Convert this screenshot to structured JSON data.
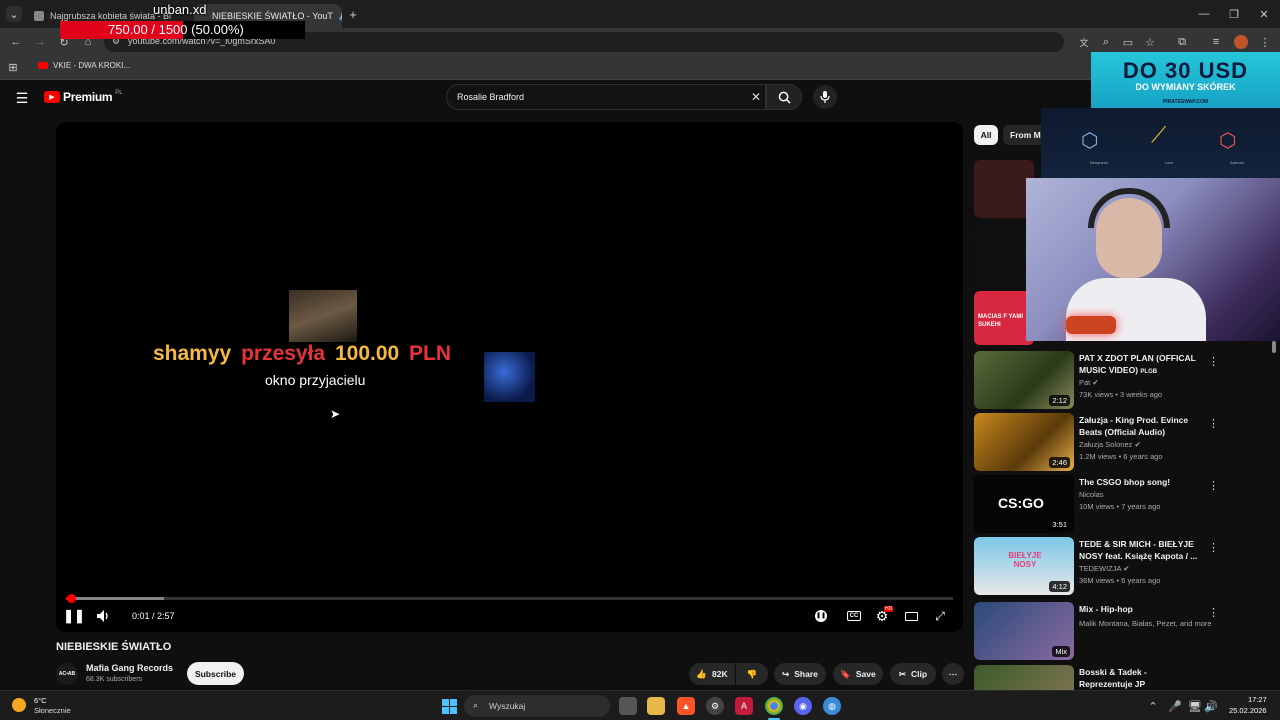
{
  "browser": {
    "tabs": [
      {
        "title": "Najgrubsza kobieta świata - Bi"
      },
      {
        "title": "NIEBIESKIE ŚWIATŁO - YouT"
      }
    ],
    "new_tab": "+",
    "url": "youtube.com/watch?v=_i0gmSrxSA0",
    "bookmark": "VKIE - DWA KROKI..."
  },
  "overlay": {
    "streamer_name": "unban.xd",
    "goal_text": "750.00 / 1500 (50.00%)",
    "goal_fraction": 0.5,
    "ad_title": "DO 30 USD",
    "ad_subtitle": "DO WYMIANY SKÓREK",
    "ad_brand": "PIRATESWAP.COM",
    "ad_skins": [
      "Neoqueen",
      "Lore",
      "Asiimov"
    ],
    "donation": {
      "user": "shamyy",
      "verb": "przesyła",
      "amount": "100.00",
      "currency": "PLN",
      "message": "okno przyjacielu"
    }
  },
  "youtube": {
    "logo": "Premium",
    "logo_region": "PL",
    "search_value": "Rosalie Bradford",
    "player": {
      "time": "0:01 / 2:57",
      "progress_fraction": 0.006,
      "buffered_fraction": 0.11
    },
    "video": {
      "title": "NIEBIESKIE ŚWIATŁO",
      "channel": "Mafia Gang Records",
      "channel_avatar": "AC•AB",
      "subscribers": "68.3K subscribers",
      "subscribe": "Subscribe",
      "likes": "82K",
      "share": "Share",
      "save": "Save",
      "clip": "Clip"
    },
    "chips": [
      "All",
      "From Ma"
    ],
    "recommendations": [
      {
        "title": "PAT X ZDOT PLAN (OFFICAL MUSIC VIDEO)",
        "badge": "PLGB",
        "channel": "Pat",
        "verified": true,
        "meta": "73K views • 3 weeks ago",
        "duration": "2:12",
        "thumb_color": "#5a6b3a"
      },
      {
        "title": "Załuzja - King Prod. Evince Beats (Official Audio)",
        "channel": "Załuzja Solonez",
        "verified": true,
        "meta": "1.2M views • 6 years ago",
        "duration": "2:46",
        "thumb_color": "#c98a1e"
      },
      {
        "title": "The CSGO bhop song!",
        "channel": "Nicolas",
        "verified": false,
        "meta": "10M views • 7 years ago",
        "duration": "3:51",
        "thumb_color": "#050505",
        "thumb_text": "CS:GO"
      },
      {
        "title": "TEDE & SIR MICH - BIEŁYJE NOSY feat. Książę Kapota / ...",
        "channel": "TEDEWIZJA",
        "verified": true,
        "meta": "36M views • 6 years ago",
        "duration": "4:12",
        "thumb_color": "#5ab0d6",
        "thumb_text": "BIEŁYJE NOSY"
      },
      {
        "title": "Mix - Hip-hop",
        "channel": "Malik Montana, Białas, Pezet, and more",
        "verified": false,
        "meta": "",
        "duration": "Mix",
        "thumb_color": "#2a4a7a"
      },
      {
        "title": "Bosski & Tadek - Reprezentuje JP",
        "channel": "",
        "verified": false,
        "meta": "",
        "duration": "",
        "thumb_color": "#3b5a2a"
      }
    ],
    "partial_items": [
      {
        "thumb_color": "#3a1a1a"
      },
      {
        "thumb_color": "#111111"
      },
      {
        "thumb_color": "#d8283f",
        "thumb_text": "MACIAS F YAMI SUKEHI"
      }
    ]
  },
  "taskbar": {
    "weather_temp": "6°C",
    "weather_desc": "Słonecznie",
    "search_placeholder": "Wyszukaj",
    "time": "17:27",
    "date": "25.02.2026"
  },
  "colors": {
    "youtube_red": "#ff0000",
    "donation_name": "#f5b942",
    "donation_verb": "#e8323a",
    "goal_bar": "#e0001a"
  }
}
